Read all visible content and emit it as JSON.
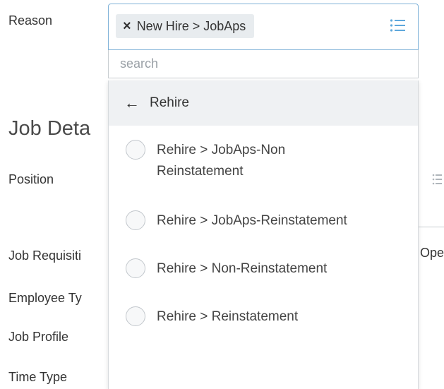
{
  "form": {
    "reason_label": "Reason",
    "section_title": "Job Deta",
    "position_label": "Position",
    "job_requisition_label": "Job Requisiti",
    "employee_type_label": "Employee Ty",
    "job_profile_label": "Job Profile",
    "time_type_label": "Time Type",
    "requisition_value_fragment": "Ope"
  },
  "reason_field": {
    "selected_value": "New Hire > JobAps",
    "remove_glyph": "×",
    "list_icon": "list-icon"
  },
  "search": {
    "placeholder": "search",
    "value": ""
  },
  "dropdown": {
    "back_glyph": "←",
    "header": "Rehire",
    "options": [
      {
        "label": "Rehire > JobAps-Non Reinstatement"
      },
      {
        "label": "Rehire > JobAps-Reinstatement"
      },
      {
        "label": "Rehire > Non-Reinstatement"
      },
      {
        "label": "Rehire > Reinstatement"
      }
    ]
  },
  "colors": {
    "accent": "#3aa3dc",
    "focus_border": "#7fb2d8",
    "pill_bg": "#e8ecef",
    "header_bg": "#eff1f3"
  }
}
